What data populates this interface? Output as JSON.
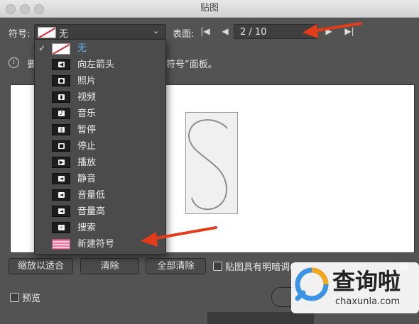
{
  "window": {
    "title": "贴图"
  },
  "symbol": {
    "label": "符号:",
    "selected": "无"
  },
  "face": {
    "label": "表面:",
    "page": "2 / 10"
  },
  "info": {
    "text_left": "要",
    "text_right": "符号”面板。"
  },
  "dropdown": {
    "items": [
      {
        "label": "无",
        "icon": "none-swatch-icon",
        "selected": true
      },
      {
        "label": "向左箭头",
        "icon": "arrow-left-icon"
      },
      {
        "label": "照片",
        "icon": "camera-icon"
      },
      {
        "label": "视频",
        "icon": "video-icon"
      },
      {
        "label": "音乐",
        "icon": "music-note-icon"
      },
      {
        "label": "暂停",
        "icon": "pause-icon"
      },
      {
        "label": "停止",
        "icon": "stop-icon"
      },
      {
        "label": "播放",
        "icon": "play-icon"
      },
      {
        "label": "静音",
        "icon": "speaker-mute-icon"
      },
      {
        "label": "音量低",
        "icon": "speaker-low-icon"
      },
      {
        "label": "音量高",
        "icon": "speaker-high-icon"
      },
      {
        "label": "搜索",
        "icon": "magnifier-icon"
      },
      {
        "label": "新建符号",
        "icon": "new-symbol-icon"
      }
    ]
  },
  "buttons": {
    "fit": "缩放以适合",
    "clear": "清除",
    "clear_all": "全部清除"
  },
  "checkbox_shade": {
    "label": "贴图具有明暗调(",
    "tail": "用"
  },
  "preview": {
    "label": "预览"
  },
  "watermark": {
    "cn": "查询啦",
    "url": "chaxunla.com"
  },
  "colors": {
    "accent": "#5db3ff",
    "annotation": "#e23d18",
    "new_symbol": "#e87aa6"
  }
}
